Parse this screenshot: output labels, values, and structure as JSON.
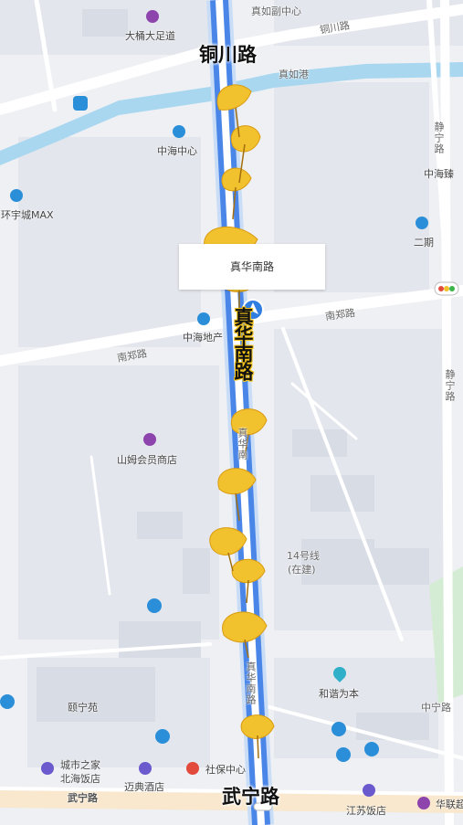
{
  "map": {
    "title_roads": {
      "top": "铜川路",
      "bottom": "武宁路",
      "main": "真华南路"
    },
    "card_label": "真华南路",
    "road_labels": {
      "zhenru_fuzhongxin": "真如副中心",
      "tongchuan_right": "铜川路",
      "zhenrugang": "真如港",
      "nanzheng_upper": "南郑路",
      "nanzheng_lower": "南郑路",
      "jingning_upper": "静宁路",
      "jingning_lower": "静宁路",
      "zhenhuanan_mid": "真华南",
      "zhenhuanan_low": "真华南路",
      "zhongning": "中宁路",
      "wuning_left": "武宁路",
      "line14": "14号线",
      "line14_status": "(在建)"
    },
    "pois": {
      "datong": "大桶大足道",
      "zhonghai_center": "中海中心",
      "huanyu": "环宇城MAX",
      "zhonghai_right": "中海臻",
      "phase2": "二期",
      "zhonghai_realty": "中海地产",
      "sams": "山姆会员商店",
      "hexie": "和谐为本",
      "yining": "颐宁苑",
      "city_home": "城市之家",
      "beihai": "北海饭店",
      "maidian": "迈典酒店",
      "social_security": "社保中心",
      "jiangsu": "江苏饭店",
      "hualian": "华联超"
    },
    "icons": [
      "shopping-bag-icon",
      "bus-stop-icon",
      "landmark-icon",
      "building-icon",
      "parking-icon",
      "pin-icon",
      "hotel-icon",
      "traffic-light-icon",
      "location-arrow-icon",
      "ginkgo-leaf-icon"
    ],
    "colors": {
      "route_blue": "#4a86e8",
      "route_light": "#c9ddf7",
      "river": "#a9d7f0",
      "ginkgo": "#f2c12e",
      "poi_purple": "#8e44ad",
      "poi_blue": "#2a8fd8",
      "poi_red": "#e24b3b"
    }
  }
}
